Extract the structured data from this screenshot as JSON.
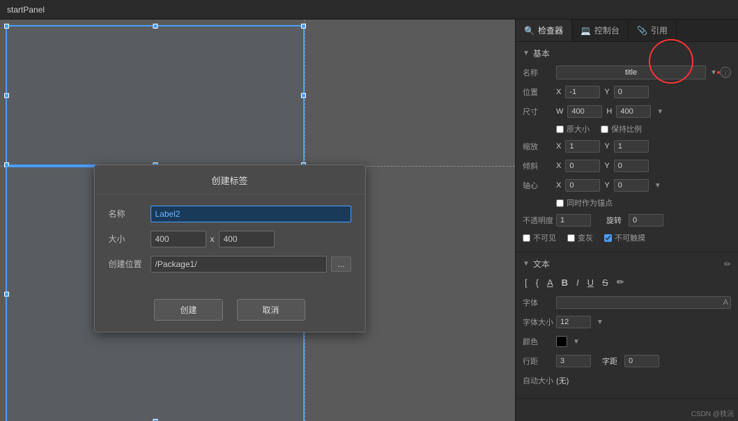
{
  "topBar": {
    "title": "startPanel"
  },
  "panelTabs": [
    {
      "id": "inspector",
      "label": "检查器",
      "icon": "🔍",
      "active": true
    },
    {
      "id": "console",
      "label": "控制台",
      "icon": "💻",
      "active": false
    },
    {
      "id": "reference",
      "label": "引用",
      "icon": "📎",
      "active": false
    }
  ],
  "basicSection": {
    "title": "基本",
    "fields": {
      "name": {
        "label": "名称",
        "value": "title"
      },
      "position": {
        "label": "位置",
        "xLabel": "X",
        "xValue": "-1",
        "yLabel": "Y",
        "yValue": "0"
      },
      "size": {
        "label": "尺寸",
        "wLabel": "W",
        "wValue": "400",
        "hLabel": "H",
        "hValue": "400"
      },
      "originalSize": {
        "label": "原大小",
        "checked": false
      },
      "keepRatio": {
        "label": "保持比例",
        "checked": false
      },
      "scale": {
        "label": "缩放",
        "xLabel": "X",
        "xValue": "1",
        "yLabel": "Y",
        "yValue": "1"
      },
      "skew": {
        "label": "倾斜",
        "xLabel": "X",
        "xValue": "0",
        "yLabel": "Y",
        "yValue": "0"
      },
      "anchor": {
        "label": "轴心",
        "xLabel": "X",
        "xValue": "0",
        "yLabel": "Y",
        "yValue": "0"
      },
      "anchorPoint": {
        "label": "同时作为锚点",
        "checked": false
      },
      "opacity": {
        "label": "不透明度",
        "value": "1"
      },
      "rotation": {
        "label": "旋转",
        "value": "0"
      },
      "invisible": {
        "label": "不可见",
        "checked": false
      },
      "gray": {
        "label": "变灰",
        "checked": false
      },
      "noTouch": {
        "label": "不可触摸",
        "checked": true
      }
    }
  },
  "textSection": {
    "title": "文本",
    "tools": [
      {
        "id": "bracket1",
        "symbol": "[",
        "tooltip": "bracket"
      },
      {
        "id": "bracket2",
        "symbol": "]",
        "tooltip": "bracket"
      },
      {
        "id": "curly1",
        "symbol": "{",
        "tooltip": "curly"
      },
      {
        "id": "curly2",
        "symbol": "}",
        "tooltip": "curly"
      },
      {
        "id": "underlineA",
        "symbol": "A̲",
        "tooltip": "underlineA"
      },
      {
        "id": "bold",
        "symbol": "B",
        "tooltip": "bold"
      },
      {
        "id": "italic",
        "symbol": "I",
        "tooltip": "italic"
      },
      {
        "id": "underline",
        "symbol": "U",
        "tooltip": "underline"
      },
      {
        "id": "strikethrough",
        "symbol": "S",
        "tooltip": "strikethrough"
      },
      {
        "id": "eraser",
        "symbol": "✏",
        "tooltip": "eraser"
      }
    ],
    "font": {
      "label": "字体",
      "value": ""
    },
    "fontSize": {
      "label": "字体大小",
      "value": "12"
    },
    "color": {
      "label": "颜色",
      "value": "#000000"
    },
    "lineHeight": {
      "label": "行距",
      "value": "3"
    },
    "letterSpacing": {
      "label": "字距",
      "value": "0"
    },
    "autoSize": {
      "label": "自动大小",
      "value": "(无)"
    }
  },
  "dialog": {
    "title": "创建标签",
    "nameLabel": "名称",
    "nameValue": "Label2",
    "sizeLabel": "大小",
    "sizeW": "400",
    "sizeX": "x",
    "sizeH": "400",
    "pathLabel": "创建位置",
    "pathValue": "/Package1/",
    "pathBtnLabel": "...",
    "createBtn": "创建",
    "cancelBtn": "取消"
  },
  "watermark": "CSDN @枝沅"
}
